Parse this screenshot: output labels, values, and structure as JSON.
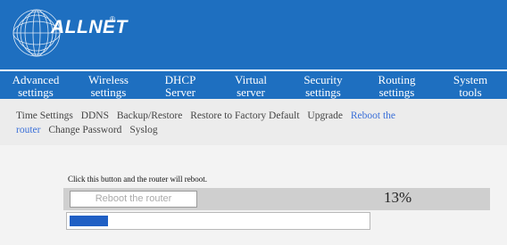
{
  "brand": {
    "logo_text": "ALLNET",
    "logo_mark": "®"
  },
  "nav": {
    "items": [
      {
        "line1": "Advanced",
        "line2": "settings"
      },
      {
        "line1": "Wireless",
        "line2": "settings"
      },
      {
        "line1": "DHCP",
        "line2": "Server"
      },
      {
        "line1": "Virtual",
        "line2": "server"
      },
      {
        "line1": "Security",
        "line2": "settings"
      },
      {
        "line1": "Routing",
        "line2": "settings"
      },
      {
        "line1": "System",
        "line2": "tools"
      }
    ],
    "active_index": 6
  },
  "subnav": {
    "items": [
      {
        "label": "Time Settings"
      },
      {
        "label": "DDNS"
      },
      {
        "label": "Backup/Restore"
      },
      {
        "label": "Restore to Factory Default"
      },
      {
        "label": "Upgrade"
      },
      {
        "label": "Reboot the"
      },
      {
        "label": "router"
      },
      {
        "label": "Change Password"
      },
      {
        "label": "Syslog"
      }
    ],
    "active_label": "Reboot the router"
  },
  "reboot": {
    "instruction": "Click this button and the router will reboot.",
    "button_label": "Reboot the router",
    "progress_text": "13%",
    "progress_fraction": 0.13
  },
  "colors": {
    "brand_blue": "#1e6fc0",
    "progress_blue": "#1f5fc4",
    "active_link": "#3a6fd8"
  }
}
